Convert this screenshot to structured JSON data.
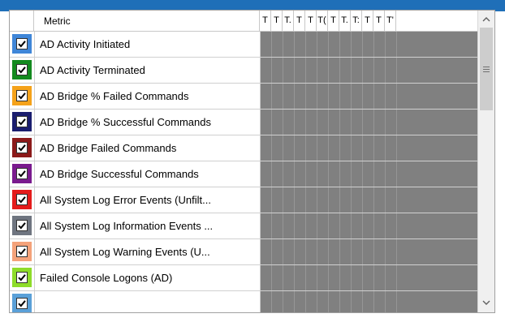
{
  "header": {
    "metric_label": "Metric",
    "time_columns": [
      "T",
      "T",
      "T.",
      "T",
      "T",
      "T(",
      "T",
      "T.",
      "T:",
      "T",
      "T",
      "T'"
    ]
  },
  "rows": [
    {
      "label": "AD Activity Initiated",
      "color": "#3f86d8",
      "checked": true
    },
    {
      "label": "AD Activity Terminated",
      "color": "#138a1f",
      "checked": true
    },
    {
      "label": "AD Bridge % Failed Commands",
      "color": "#f5a21a",
      "checked": true
    },
    {
      "label": "AD Bridge % Successful Commands",
      "color": "#1a1d6e",
      "checked": true
    },
    {
      "label": "AD Bridge Failed Commands",
      "color": "#8b1a1a",
      "checked": true
    },
    {
      "label": "AD Bridge Successful Commands",
      "color": "#7a1a8e",
      "checked": true
    },
    {
      "label": "All System Log Error Events (Unfilt...",
      "color": "#e41c1c",
      "checked": true
    },
    {
      "label": "All System Log Information Events ...",
      "color": "#6f7580",
      "checked": true
    },
    {
      "label": "All System Log Warning Events (U...",
      "color": "#f4a27a",
      "checked": true
    },
    {
      "label": "Failed Console Logons (AD)",
      "color": "#8edc2a",
      "checked": true
    },
    {
      "label": "",
      "color": "#5aa0d8",
      "checked": true
    }
  ],
  "scrollbar": {
    "up_icon": "chevron-up-icon",
    "down_icon": "chevron-down-icon",
    "grip_icon": "grip-icon"
  }
}
